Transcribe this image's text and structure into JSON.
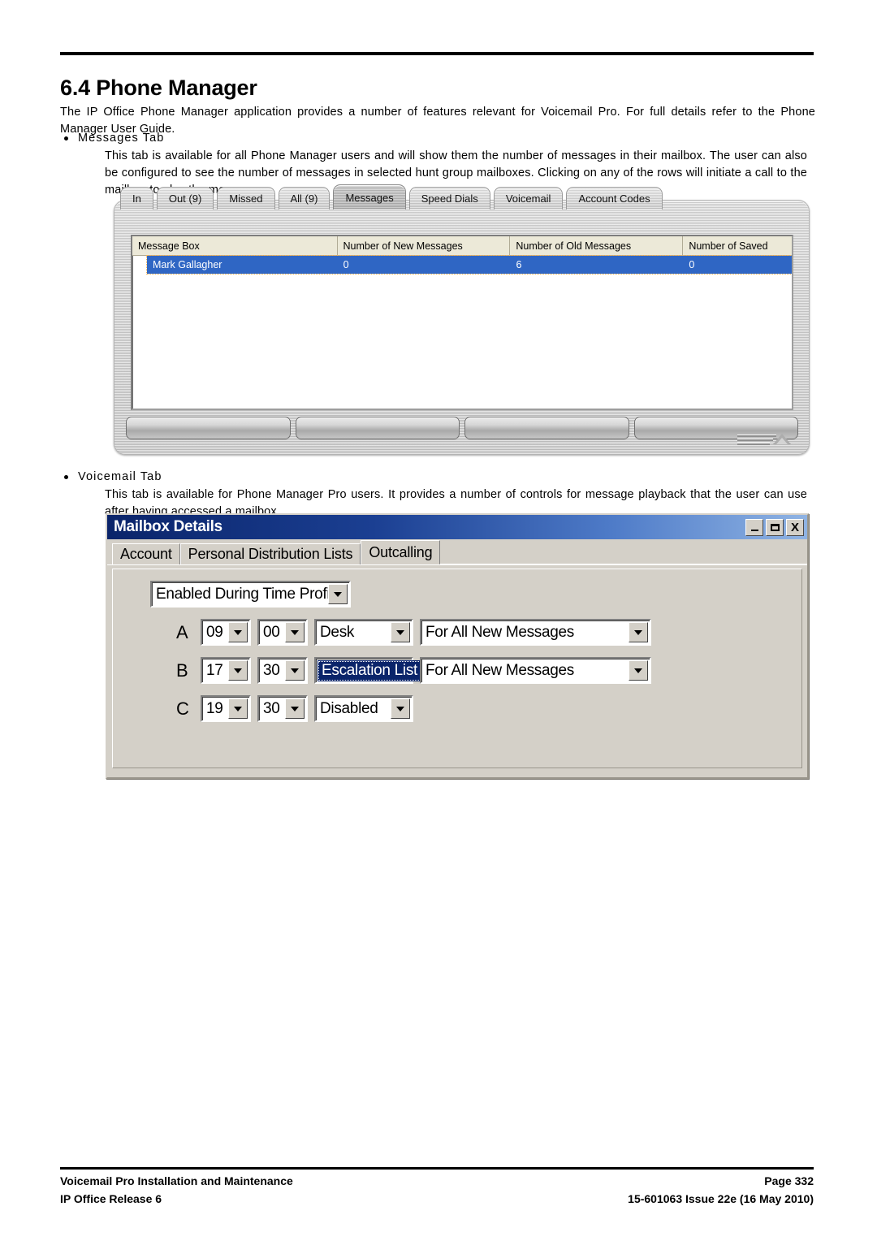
{
  "document": {
    "section_number_title": "6.4 Phone Manager",
    "intro": "The IP Office Phone Manager application provides a number of features relevant for Voicemail Pro. For full details refer to the Phone Manager User Guide."
  },
  "bullets": [
    {
      "heading": "Messages Tab",
      "body": "This tab is available for all Phone Manager users and will show them the number of messages in their mailbox. The user can also be configured to see the number of messages in selected hunt group mailboxes. Clicking on any of the rows will initiate a call to the mailbox to play the messages."
    },
    {
      "heading": "Voicemail Tab",
      "body": "This tab is available for Phone Manager Pro users. It provides a number of controls for message playback that the user can use after having accessed a mailbox."
    }
  ],
  "phone_manager": {
    "tabs": [
      {
        "label": "In",
        "active": false
      },
      {
        "label": "Out (9)",
        "active": false
      },
      {
        "label": "Missed",
        "active": false
      },
      {
        "label": "All (9)",
        "active": false
      },
      {
        "label": "Messages",
        "active": true
      },
      {
        "label": "Speed Dials",
        "active": false
      },
      {
        "label": "Voicemail",
        "active": false
      },
      {
        "label": "Account Codes",
        "active": false
      }
    ],
    "grid": {
      "columns": [
        "Message Box",
        "Number of New Messages",
        "Number of Old Messages",
        "Number of Saved"
      ],
      "rows": [
        {
          "message_box": "Mark Gallagher",
          "new_messages": "0",
          "old_messages": "6",
          "saved_messages": "0",
          "selected": true
        }
      ]
    },
    "soft_keys": [
      "",
      "",
      "",
      ""
    ],
    "logo": "avaya-logo"
  },
  "mailbox_details": {
    "title": "Mailbox Details",
    "window_buttons": [
      {
        "name": "minimize",
        "glyph": "_"
      },
      {
        "name": "maximize",
        "glyph": "□"
      },
      {
        "name": "close",
        "glyph": "X"
      }
    ],
    "tabs": [
      {
        "label": "Account",
        "active": false
      },
      {
        "label": "Personal Distribution Lists",
        "active": false
      },
      {
        "label": "Outcalling",
        "active": true
      }
    ],
    "outcalling": {
      "profile": "Enabled During Time Profile",
      "rows": [
        {
          "label": "A",
          "hour": "09",
          "minute": "00",
          "destination": "Desk",
          "condition": "For All New Messages",
          "destination_selected": false,
          "has_condition": true
        },
        {
          "label": "B",
          "hour": "17",
          "minute": "30",
          "destination": "Escalation List",
          "condition": "For All New Messages",
          "destination_selected": true,
          "has_condition": true
        },
        {
          "label": "C",
          "hour": "19",
          "minute": "30",
          "destination": "Disabled",
          "condition": "",
          "destination_selected": false,
          "has_condition": false
        }
      ]
    }
  },
  "footer": {
    "left_line1": "Voicemail Pro Installation and Maintenance",
    "left_line2": "IP Office Release 6",
    "right_line1": "Page 332",
    "right_line2": "15-601063 Issue 22e (16 May 2010)"
  }
}
